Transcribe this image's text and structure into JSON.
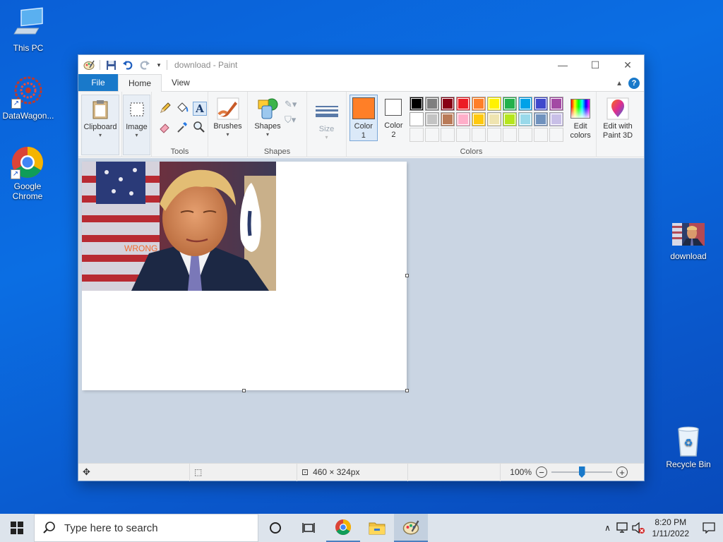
{
  "desktop": {
    "icons": [
      {
        "label": "This PC"
      },
      {
        "label": "DataWagon..."
      },
      {
        "label": "Google Chrome"
      },
      {
        "label": "download"
      },
      {
        "label": "Recycle Bin"
      }
    ]
  },
  "window": {
    "title": "download - Paint",
    "controls": {
      "minimize": "—",
      "maximize": "☐",
      "close": "✕"
    }
  },
  "tabs": {
    "file": "File",
    "home": "Home",
    "view": "View"
  },
  "ribbon": {
    "clipboard": {
      "label": "Clipboard"
    },
    "image": {
      "label": "Image"
    },
    "tools": {
      "group_label": "Tools"
    },
    "brushes": {
      "label": "Brushes"
    },
    "shapes": {
      "label": "Shapes",
      "group_label": "Shapes"
    },
    "size": {
      "label": "Size"
    },
    "color1": {
      "label": "Color",
      "sub": "1",
      "value": "#ff7f27"
    },
    "color2": {
      "label": "Color",
      "sub": "2",
      "value": "#ffffff"
    },
    "colors_group_label": "Colors",
    "edit_colors": {
      "line1": "Edit",
      "line2": "colors"
    },
    "paint3d": {
      "line1": "Edit with",
      "line2": "Paint 3D"
    },
    "palette_row1": [
      "#000000",
      "#7f7f7f",
      "#880015",
      "#ed1c24",
      "#ff7f27",
      "#fff200",
      "#22b14c",
      "#00a2e8",
      "#3f48cc",
      "#a349a4"
    ],
    "palette_row2": [
      "#ffffff",
      "#c3c3c3",
      "#b97a57",
      "#ffaec9",
      "#ffc90e",
      "#efe4b0",
      "#b5e61d",
      "#99d9ea",
      "#7092be",
      "#c8bfe7"
    ]
  },
  "canvas": {
    "overlay_text": "WRONG"
  },
  "statusbar": {
    "size": "460 × 324px",
    "zoom": "100%",
    "zoom_level": 0.5
  },
  "taskbar": {
    "search_placeholder": "Type here to search",
    "time": "8:20 PM",
    "date": "1/11/2022"
  }
}
